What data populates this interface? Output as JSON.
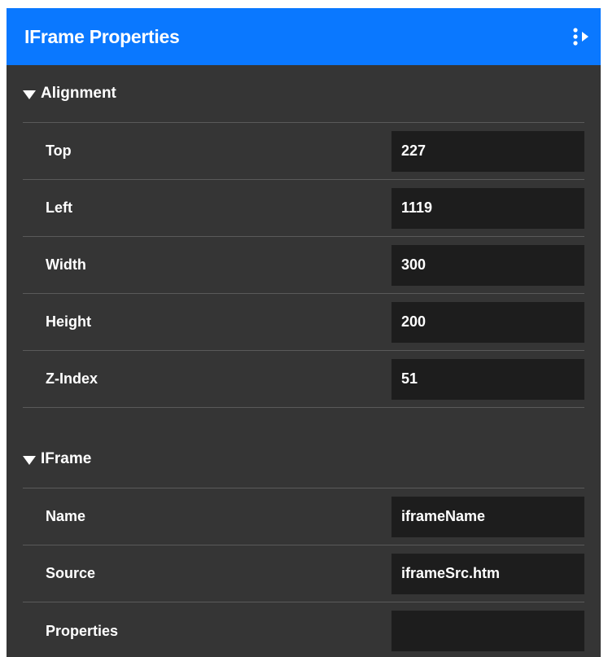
{
  "header": {
    "title": "IFrame Properties",
    "menu_icon": "more-vertical-arrow-icon"
  },
  "alignment": {
    "title": "Alignment",
    "rows": [
      {
        "label": "Top",
        "value": "227"
      },
      {
        "label": "Left",
        "value": "1119"
      },
      {
        "label": "Width",
        "value": "300"
      },
      {
        "label": "Height",
        "value": "200"
      },
      {
        "label": "Z-Index",
        "value": "51"
      }
    ]
  },
  "iframe": {
    "title": "IFrame",
    "rows": [
      {
        "label": "Name",
        "value": "iframeName"
      },
      {
        "label": "Source",
        "value": "iframeSrc.htm"
      },
      {
        "label": "Properties",
        "value": ""
      }
    ]
  },
  "colors": {
    "header_bg": "#0a78ff",
    "panel_bg": "#353535",
    "input_bg": "#1d1d1d",
    "divider": "#5a5a5a",
    "text": "#ffffff"
  }
}
